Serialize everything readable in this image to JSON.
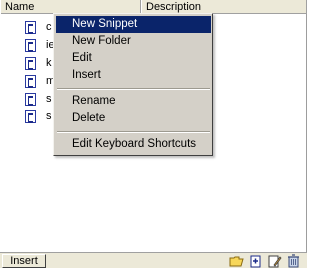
{
  "columns": {
    "name": "Name",
    "description": "Description"
  },
  "items": [
    {
      "label": "c"
    },
    {
      "label": "ie"
    },
    {
      "label": "k"
    },
    {
      "label": "m"
    },
    {
      "label": "s"
    },
    {
      "label": "s"
    }
  ],
  "context_menu": {
    "items": [
      "New Snippet",
      "New Folder",
      "Edit",
      "Insert",
      "Rename",
      "Delete",
      "Edit Keyboard Shortcuts"
    ],
    "selected": "New Snippet"
  },
  "bottom_bar": {
    "insert_label": "Insert",
    "icons": [
      "folder-icon",
      "new-snippet-icon",
      "edit-icon",
      "trash-icon"
    ]
  },
  "colors": {
    "menu_background": "#d4d0c8",
    "menu_highlight": "#0a246a",
    "header_background": "#ece9d8"
  }
}
